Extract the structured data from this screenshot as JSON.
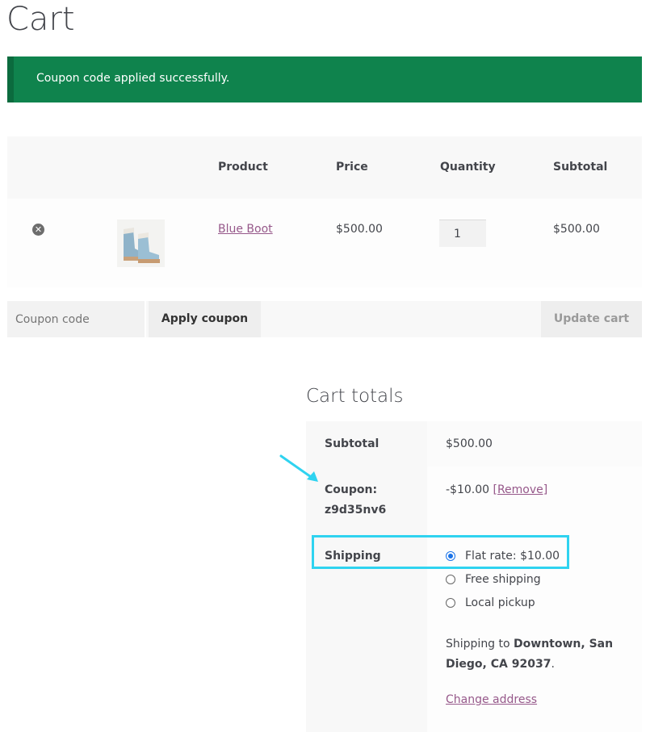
{
  "page": {
    "title": "Cart"
  },
  "notice": {
    "message": "Coupon code applied successfully."
  },
  "cart_table": {
    "headers": {
      "product": "Product",
      "price": "Price",
      "quantity": "Quantity",
      "subtotal": "Subtotal"
    },
    "items": [
      {
        "name": "Blue Boot",
        "price": "$500.00",
        "quantity": "1",
        "subtotal": "$500.00",
        "image_icon": "boot-thumbnail"
      }
    ]
  },
  "actions": {
    "coupon_placeholder": "Coupon code",
    "apply_label": "Apply coupon",
    "update_label": "Update cart"
  },
  "totals": {
    "title": "Cart totals",
    "subtotal_label": "Subtotal",
    "subtotal_value": "$500.00",
    "coupon_label": "Coupon:",
    "coupon_code": "z9d35nv6",
    "coupon_value": "-$10.00",
    "coupon_remove": "[Remove]",
    "shipping_label": "Shipping",
    "shipping_options": [
      {
        "label": "Flat rate: $10.00",
        "selected": true
      },
      {
        "label": "Free shipping",
        "selected": false
      },
      {
        "label": "Local pickup",
        "selected": false
      }
    ],
    "shipping_to_prefix": "Shipping to",
    "shipping_address": "Downtown, San Diego, CA 92037",
    "shipping_to_suffix": ".",
    "change_address": "Change address"
  },
  "colors": {
    "notice_bg": "#0f834d",
    "link": "#96588a",
    "highlight": "#2fd3f0"
  }
}
